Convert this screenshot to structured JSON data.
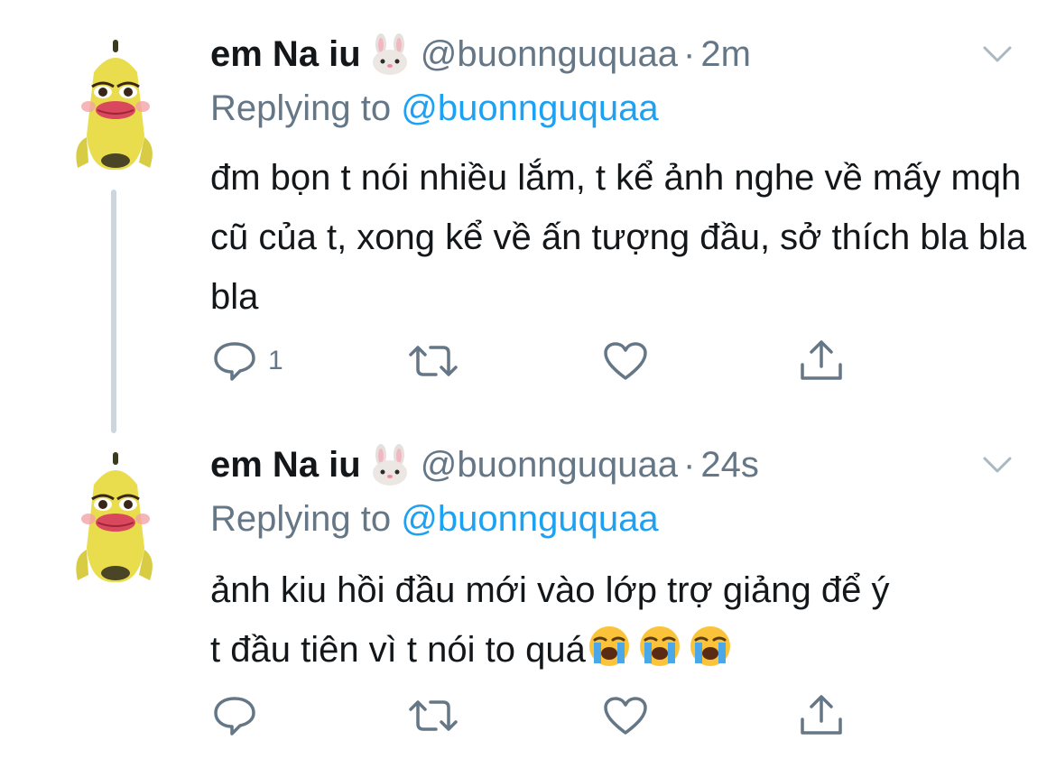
{
  "tweets": [
    {
      "display_name": "em Na iu",
      "name_emoji": "rabbit-face",
      "handle": "@buonnguquaa",
      "separator": "·",
      "time": "2m",
      "replying_prefix": "Replying to",
      "replying_to": "@buonnguquaa",
      "text": "đm bọn t nói nhiều lắm, t kể ảnh nghe về mấy mqh cũ của t, xong kể về ấn tượng đầu, sở thích bla bla bla",
      "reply_count": "1"
    },
    {
      "display_name": "em Na iu",
      "name_emoji": "rabbit-face",
      "handle": "@buonnguquaa",
      "separator": "·",
      "time": "24s",
      "replying_prefix": "Replying to",
      "replying_to": "@buonnguquaa",
      "text_line1": "ảnh kiu hồi đầu mới vào lớp trợ giảng để ý",
      "text_line2": "t đầu tiên vì t nói to quá",
      "text_emojis": [
        "loudly-crying-face",
        "loudly-crying-face",
        "loudly-crying-face"
      ],
      "reply_count": ""
    }
  ],
  "icons": {
    "reply": "speech-bubble-icon",
    "retweet": "retweet-icon",
    "like": "heart-icon",
    "share": "share-icon",
    "more": "chevron-down-icon"
  },
  "colors": {
    "text": "#14171a",
    "secondary": "#657786",
    "link": "#1da1f2",
    "thread_line": "#ccd6dd"
  }
}
